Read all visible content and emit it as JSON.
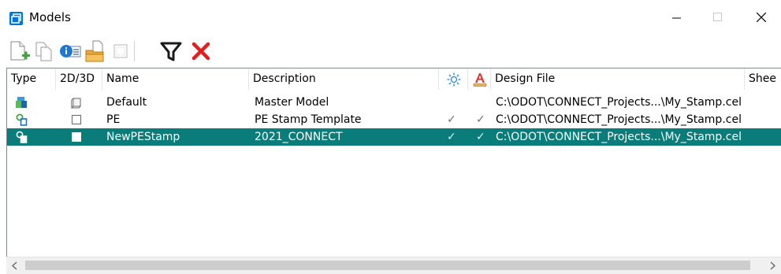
{
  "window": {
    "title": "Models",
    "app_icon": "models-window-icon",
    "controls": {
      "minimize": "minimize-icon",
      "maximize": "maximize-icon",
      "close": "close-icon"
    }
  },
  "toolbar": {
    "buttons": [
      {
        "name": "create-model-button",
        "icon": "new-model-icon"
      },
      {
        "name": "copy-model-button",
        "icon": "copy-icon"
      },
      {
        "name": "model-properties-button",
        "icon": "properties-icon"
      },
      {
        "name": "import-button",
        "icon": "folder-import-icon"
      },
      {
        "name": "disabled-button",
        "icon": "disabled-box-icon"
      },
      {
        "name": "filter-button",
        "icon": "filter-icon"
      },
      {
        "name": "delete-button",
        "icon": "delete-icon"
      }
    ]
  },
  "columns": {
    "type": "Type",
    "dim": "2D/3D",
    "name": "Name",
    "description": "Description",
    "display_icon": "sun-icon",
    "annotation_icon": "annotation-scale-icon",
    "design_file": "Design File",
    "sheet": "Shee"
  },
  "rows": [
    {
      "type_icon": "3d-model-icon",
      "dim_icon": "cube-icon",
      "name": "Default",
      "description": "Master Model",
      "col_a": "",
      "col_b": "",
      "design_file": "C:\\ODOT\\CONNECT_Projects...\\My_Stamp.cel",
      "selected": false
    },
    {
      "type_icon": "cell-model-icon",
      "dim_icon": "square-icon",
      "name": "PE",
      "description": "PE Stamp Template",
      "col_a": "✓",
      "col_b": "✓",
      "design_file": "C:\\ODOT\\CONNECT_Projects...\\My_Stamp.cel",
      "selected": false
    },
    {
      "type_icon": "cell-model-icon",
      "dim_icon": "square-icon",
      "name": "NewPEStamp",
      "description": "2021_CONNECT",
      "col_a": "✓",
      "col_b": "✓",
      "design_file": "C:\\ODOT\\CONNECT_Projects...\\My_Stamp.cel",
      "selected": true
    }
  ],
  "colors": {
    "selection": "#0a7d7b",
    "delete": "#e02020",
    "accent": "#0078d7"
  }
}
